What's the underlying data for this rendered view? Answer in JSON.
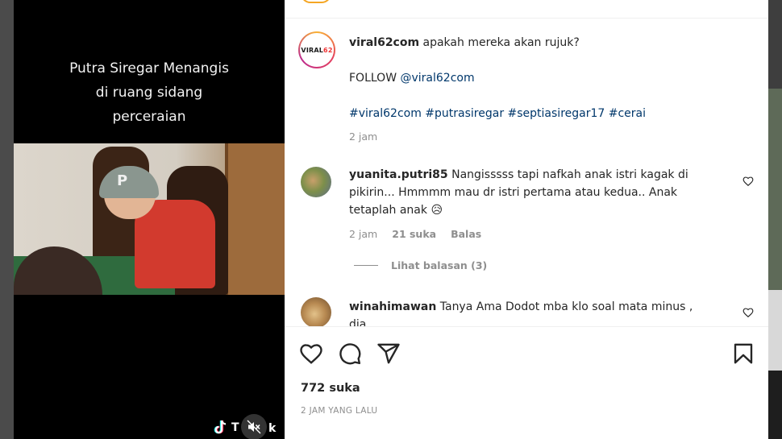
{
  "video": {
    "caption_lines": [
      "Putra Siregar Menangis",
      "di ruang sidang",
      "perceraian"
    ],
    "cap_letter": "P",
    "watermark_text": "T",
    "watermark_tail": "k"
  },
  "post": {
    "avatar_logo_text": "VIRAL",
    "avatar_logo_red": "62",
    "username": "viral62com",
    "caption": "apakah mereka akan rujuk?",
    "follow_prefix": "FOLLOW ",
    "follow_mention": "@viral62com",
    "hashtags": "#viral62com #putrasiregar #septiasiregar17 #cerai",
    "time": "2 jam"
  },
  "comments": [
    {
      "username": "yuanita.putri85",
      "text": "Nangisssss tapi nafkah anak istri kagak di pikirin... Hmmmm mau dr istri pertama atau kedua.. Anak tetaplah anak 😥",
      "time": "2 jam",
      "likes": "21 suka",
      "reply": "Balas",
      "view_replies": "Lihat balasan (3)"
    },
    {
      "username": "winahimawan",
      "text": "Tanya Ama Dodot mba klo soal mata minus , dia",
      "time": "",
      "likes": "",
      "reply": ""
    }
  ],
  "footer": {
    "likes": "772 suka",
    "posted": "2 JAM YANG LALU"
  },
  "icons": {
    "like": "heart-icon",
    "comment": "comment-icon",
    "share": "share-icon",
    "save": "bookmark-icon",
    "mute": "mute-icon",
    "tiktok": "tiktok-icon"
  }
}
